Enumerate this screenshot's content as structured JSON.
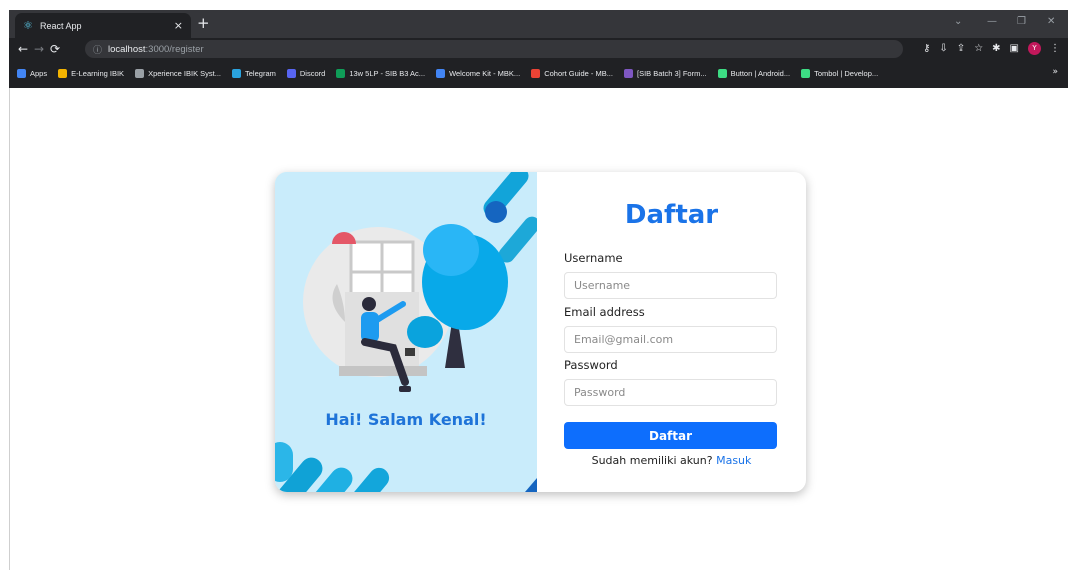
{
  "browser": {
    "tab_title": "React App",
    "tab_icon": "react-icon",
    "url_host": "localhost",
    "url_path": ":3000/register",
    "bookmarks": [
      {
        "label": "Apps",
        "color": "#4285f4"
      },
      {
        "label": "E-Learning IBIK",
        "color": "#f4b400"
      },
      {
        "label": "Xperience IBIK Syst...",
        "color": "#9aa0a6"
      },
      {
        "label": "Telegram",
        "color": "#2aa3df"
      },
      {
        "label": "Discord",
        "color": "#5865f2"
      },
      {
        "label": "13w 5LP - SIB B3 Ac...",
        "color": "#0f9d58"
      },
      {
        "label": "Welcome Kit - MBK...",
        "color": "#4285f4"
      },
      {
        "label": "Cohort Guide - MB...",
        "color": "#ea4335"
      },
      {
        "label": "[SIB Batch 3] Form...",
        "color": "#7e57c2"
      },
      {
        "label": "Button | Android...",
        "color": "#3ddc84"
      },
      {
        "label": "Tombol | Develop...",
        "color": "#3ddc84"
      }
    ]
  },
  "illustration": {
    "greeting": "Hai! Salam Kenal!"
  },
  "form": {
    "title": "Daftar",
    "username_label": "Username",
    "username_placeholder": "Username",
    "email_label": "Email address",
    "email_placeholder": "Email@gmail.com",
    "password_label": "Password",
    "password_placeholder": "Password",
    "submit_label": "Daftar",
    "login_prompt": "Sudah memiliki akun?",
    "login_link": "Masuk"
  },
  "colors": {
    "accent": "#0d6efd",
    "title": "#1a73e8",
    "greeting": "#1e73d8"
  }
}
